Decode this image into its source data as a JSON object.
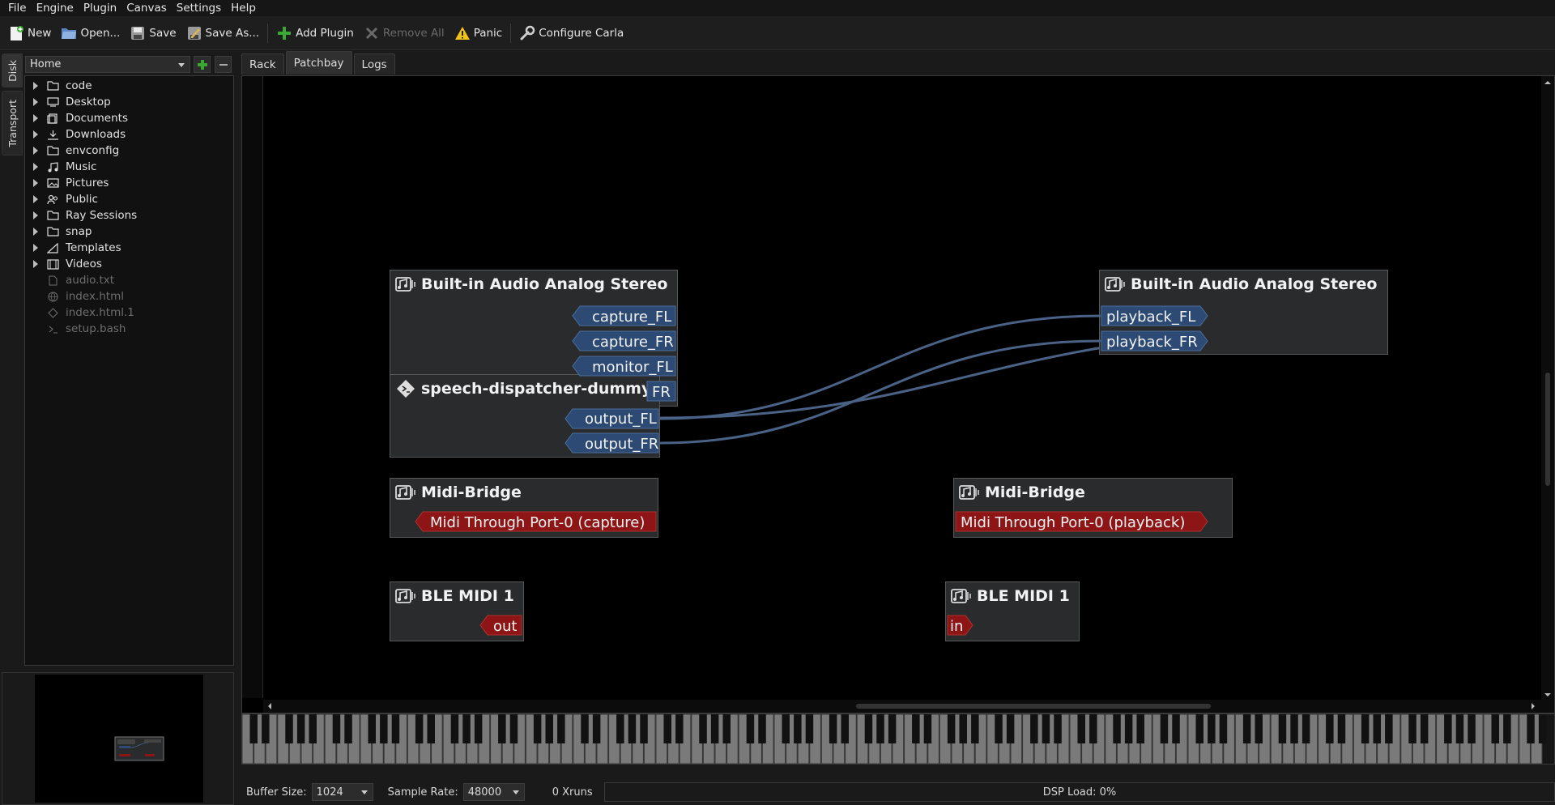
{
  "menu": [
    "File",
    "Engine",
    "Plugin",
    "Canvas",
    "Settings",
    "Help"
  ],
  "toolbar": {
    "new": "New",
    "open": "Open...",
    "save": "Save",
    "save_as": "Save As...",
    "add_plugin": "Add Plugin",
    "remove_all": "Remove All",
    "panic": "Panic",
    "configure": "Configure Carla"
  },
  "side_tabs": [
    "Disk",
    "Transport"
  ],
  "browser": {
    "location": "Home",
    "folders": [
      "code",
      "Desktop",
      "Documents",
      "Downloads",
      "envconfig",
      "Music",
      "Pictures",
      "Public",
      "Ray Sessions",
      "snap",
      "Templates",
      "Videos"
    ],
    "files": [
      "audio.txt",
      "index.html",
      "index.html.1",
      "setup.bash"
    ]
  },
  "main_tabs": [
    "Rack",
    "Patchbay",
    "Logs"
  ],
  "patchbay": {
    "nodes": {
      "capture_node": {
        "title": "Built-in Audio Analog Stereo",
        "ports": [
          "capture_FL",
          "capture_FR",
          "monitor_FL",
          "FR"
        ]
      },
      "speech_node": {
        "title": "speech-dispatcher-dummy",
        "ports": [
          "output_FL",
          "output_FR"
        ]
      },
      "playback_node": {
        "title": "Built-in Audio Analog Stereo",
        "ports": [
          "playback_FL",
          "playback_FR"
        ]
      },
      "midi_cap_node": {
        "title": "Midi-Bridge",
        "ports": [
          "Midi Through Port-0 (capture)"
        ]
      },
      "midi_play_node": {
        "title": "Midi-Bridge",
        "ports": [
          "Midi Through Port-0 (playback)"
        ]
      },
      "ble_out_node": {
        "title": "BLE MIDI 1",
        "ports": [
          "out"
        ]
      },
      "ble_in_node": {
        "title": "BLE MIDI 1",
        "ports": [
          "in"
        ]
      }
    }
  },
  "status": {
    "buffer_label": "Buffer Size:",
    "buffer_value": "1024",
    "rate_label": "Sample Rate:",
    "rate_value": "48000",
    "xruns": "0 Xruns",
    "dsp": "DSP Load: 0%"
  },
  "colors": {
    "audio_port": "#2c4a73",
    "midi_port": "#8e1515",
    "connection": "#4a6286"
  }
}
